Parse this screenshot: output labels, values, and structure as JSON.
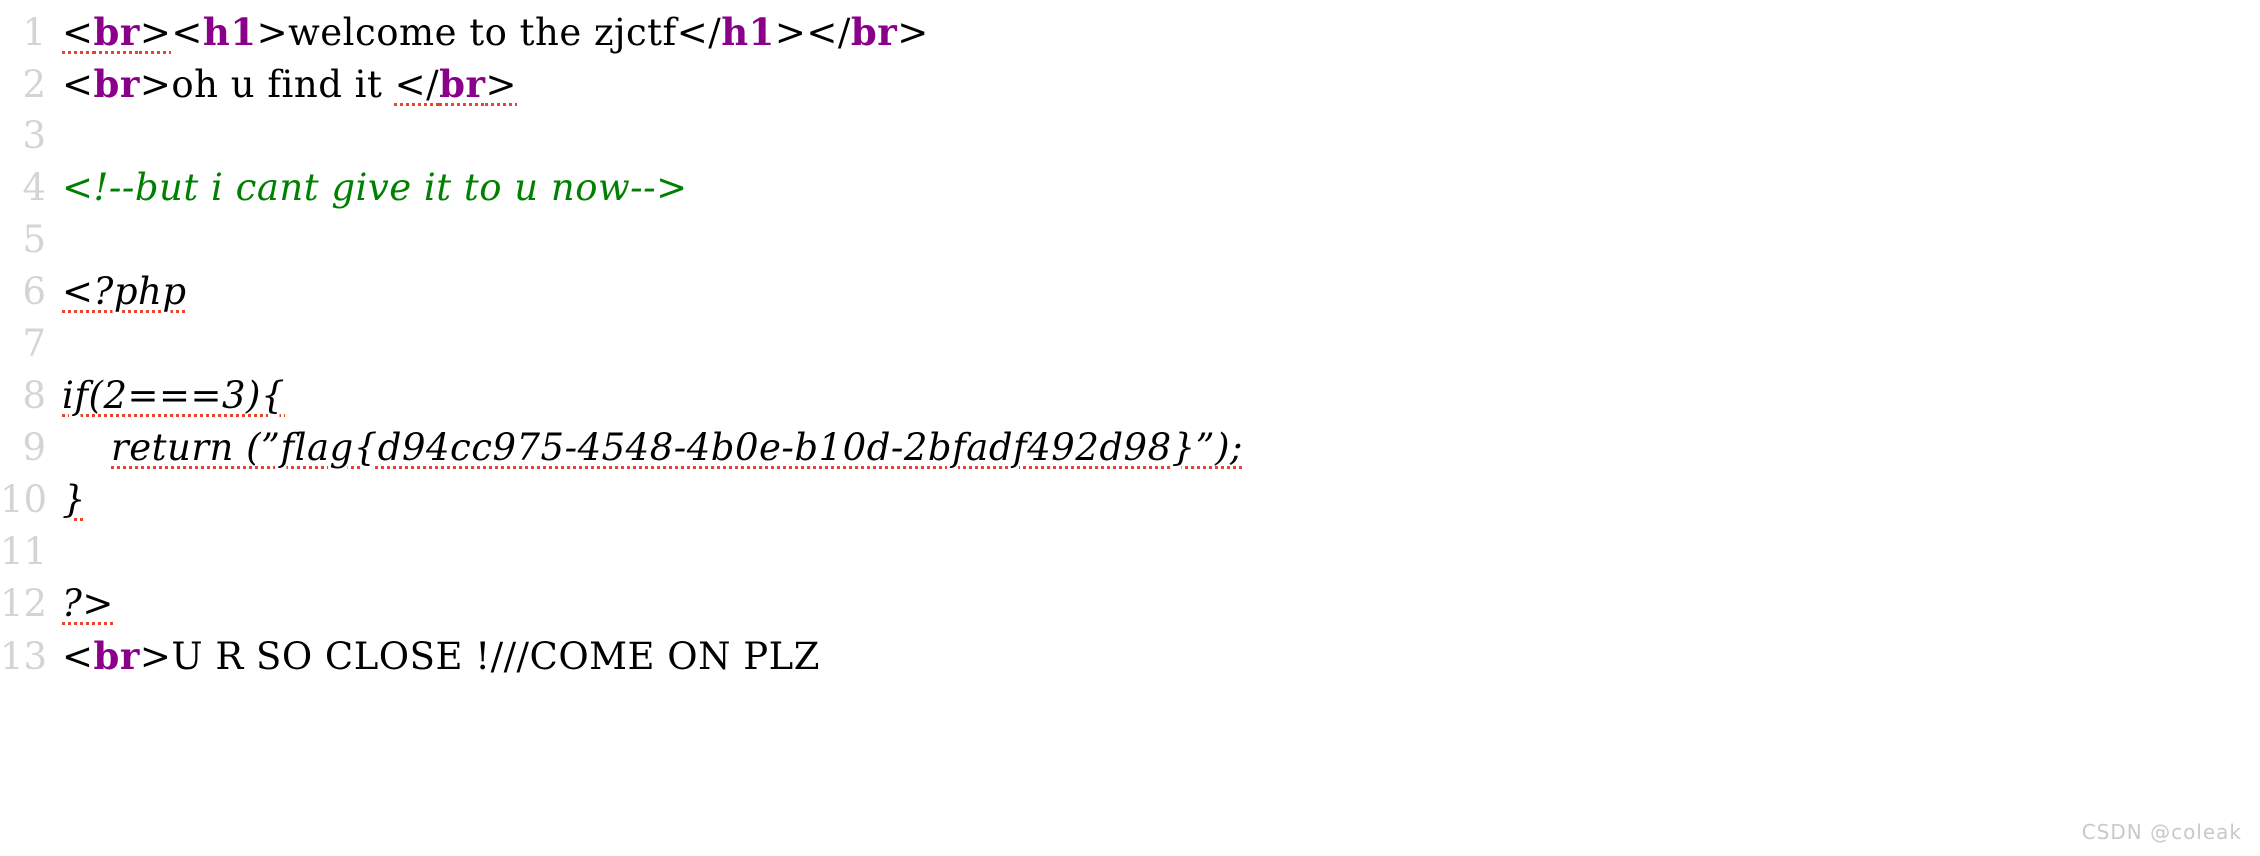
{
  "view": {
    "kind": "source-code-view",
    "language": "php-html",
    "background_color": "#ffffff",
    "line_number_color": "#d4d4d4",
    "tag_color": "#8b008b",
    "comment_color": "#008000",
    "text_color": "#000000",
    "spellcheck_underline_color": "#e8442e"
  },
  "gutter": {
    "line_numbers": [
      "1",
      "2",
      "3",
      "4",
      "5",
      "6",
      "7",
      "8",
      "9",
      "10",
      "11",
      "12",
      "13"
    ]
  },
  "lines": [
    {
      "number": "1",
      "text": "<br><h1>welcome to the zjctf</h1></br>",
      "tokens": [
        {
          "kind": "bracket",
          "text": "<",
          "spell": true
        },
        {
          "kind": "tag",
          "text": "br",
          "spell": true
        },
        {
          "kind": "bracket",
          "text": ">",
          "spell": true
        },
        {
          "kind": "bracket",
          "text": "<"
        },
        {
          "kind": "tag",
          "text": "h1"
        },
        {
          "kind": "bracket",
          "text": ">"
        },
        {
          "kind": "text",
          "text": "welcome to the zjctf"
        },
        {
          "kind": "bracket",
          "text": "</"
        },
        {
          "kind": "tag",
          "text": "h1"
        },
        {
          "kind": "bracket",
          "text": ">"
        },
        {
          "kind": "bracket",
          "text": "</"
        },
        {
          "kind": "tag",
          "text": "br"
        },
        {
          "kind": "bracket",
          "text": ">"
        }
      ]
    },
    {
      "number": "2",
      "text": "<br>oh u find it </br>",
      "tokens": [
        {
          "kind": "bracket",
          "text": "<"
        },
        {
          "kind": "tag",
          "text": "br"
        },
        {
          "kind": "bracket",
          "text": ">"
        },
        {
          "kind": "text",
          "text": "oh u find it "
        },
        {
          "kind": "bracket",
          "text": "</",
          "spell": true
        },
        {
          "kind": "tag",
          "text": "br",
          "spell": true
        },
        {
          "kind": "bracket",
          "text": ">",
          "spell": true
        }
      ]
    },
    {
      "number": "3",
      "text": "",
      "tokens": []
    },
    {
      "number": "4",
      "text": "<!--but i cant give it to u now-->",
      "tokens": [
        {
          "kind": "comment",
          "text": "<!--but i cant give it to u now-->"
        }
      ]
    },
    {
      "number": "5",
      "text": "",
      "tokens": []
    },
    {
      "number": "6",
      "text": "<?php",
      "tokens": [
        {
          "kind": "php",
          "text": "<?php",
          "spell": true
        }
      ]
    },
    {
      "number": "7",
      "text": "",
      "tokens": []
    },
    {
      "number": "8",
      "text": "if(2===3){",
      "tokens": [
        {
          "kind": "php",
          "text": "if(2===3){",
          "spell": true
        }
      ]
    },
    {
      "number": "9",
      "text": "    return (\"flag{d94cc975-4548-4b0e-b10d-2bfadf492d98}\");",
      "indent": "    ",
      "tokens": [
        {
          "kind": "php",
          "text": "return (”flag{d94cc975-4548-4b0e-b10d-2bfadf492d98}”);",
          "spell": true
        }
      ]
    },
    {
      "number": "10",
      "text": "}",
      "tokens": [
        {
          "kind": "php",
          "text": "}",
          "spell": true
        }
      ]
    },
    {
      "number": "11",
      "text": "",
      "tokens": []
    },
    {
      "number": "12",
      "text": "?>",
      "tokens": [
        {
          "kind": "php",
          "text": "?>",
          "spell": true
        }
      ]
    },
    {
      "number": "13",
      "text": "<br>U R SO CLOSE !///COME ON PLZ",
      "tokens": [
        {
          "kind": "bracket",
          "text": "<"
        },
        {
          "kind": "tag",
          "text": "br"
        },
        {
          "kind": "bracket",
          "text": ">"
        },
        {
          "kind": "text",
          "text": "U R SO CLOSE !///COME ON PLZ"
        }
      ]
    }
  ],
  "flag": {
    "value": "flag{d94cc975-4548-4b0e-b10d-2bfadf492d98}"
  },
  "watermark": {
    "text": "CSDN @coleak"
  }
}
